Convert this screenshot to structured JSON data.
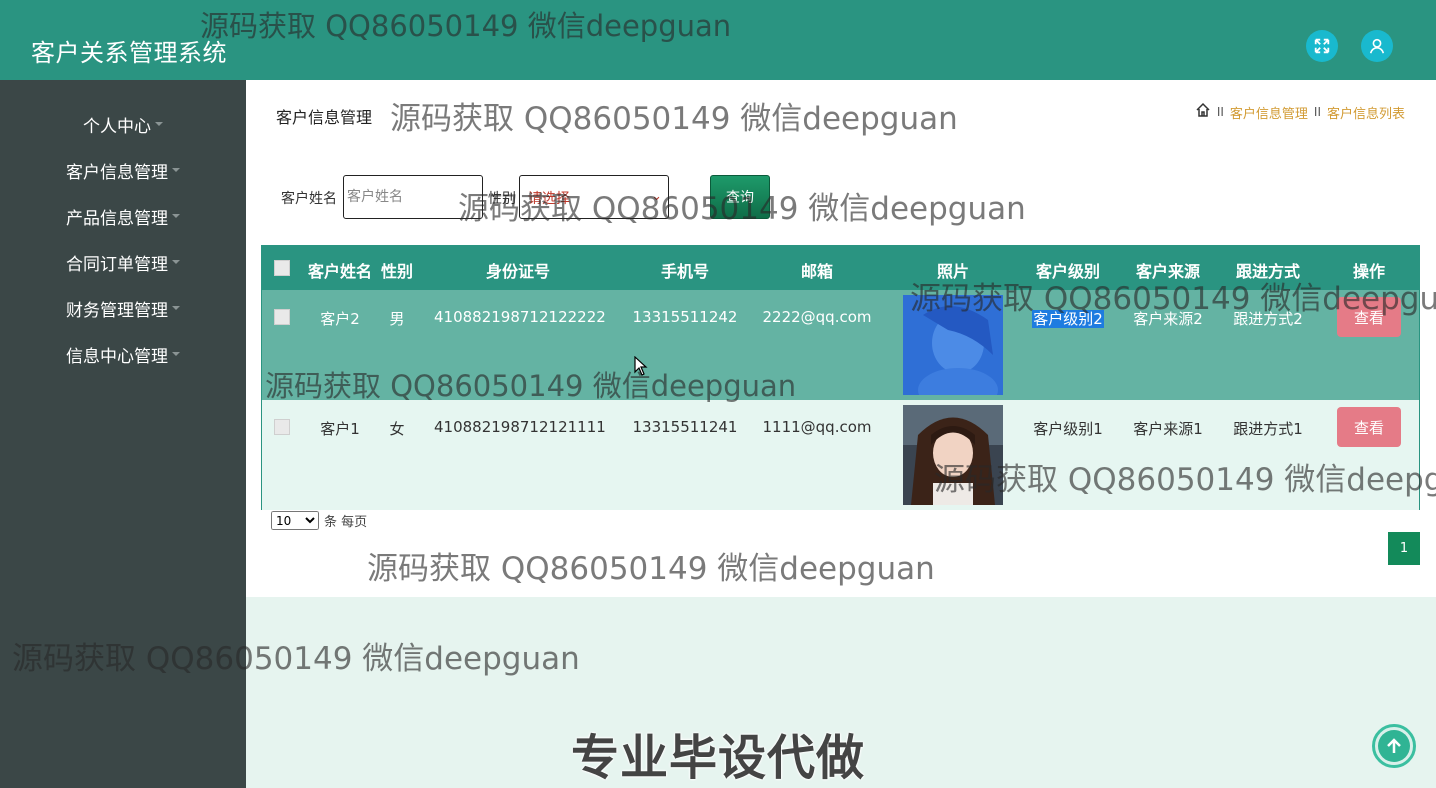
{
  "app": {
    "title": "客户关系管理系统"
  },
  "topbar": {
    "icons": [
      "fullscreen-icon",
      "user-icon"
    ]
  },
  "sidebar": {
    "items": [
      {
        "label": "个人中心"
      },
      {
        "label": "客户信息管理"
      },
      {
        "label": "产品信息管理"
      },
      {
        "label": "合同订单管理"
      },
      {
        "label": "财务管理管理"
      },
      {
        "label": "信息中心管理"
      }
    ]
  },
  "page": {
    "heading": "客户信息管理",
    "breadcrumb": {
      "sep1": "II",
      "level1": "客户信息管理",
      "sep2": "II",
      "level2": "客户信息列表"
    }
  },
  "search": {
    "name_label": "客户姓名",
    "name_placeholder": "客户姓名",
    "gender_label": "性别",
    "gender_value": "请选择",
    "query_button": "查询"
  },
  "table": {
    "columns": [
      "客户姓名",
      "性别",
      "身份证号",
      "手机号",
      "邮箱",
      "照片",
      "客户级别",
      "客户来源",
      "跟进方式",
      "操作"
    ],
    "rows": [
      {
        "name": "客户2",
        "gender": "男",
        "id_number": "410882198712122222",
        "phone": "13315511242",
        "email": "2222@qq.com",
        "level": "客户级别2",
        "source": "客户来源2",
        "follow": "跟进方式2",
        "action": "查看"
      },
      {
        "name": "客户1",
        "gender": "女",
        "id_number": "410882198712121111",
        "phone": "13315511241",
        "email": "1111@qq.com",
        "level": "客户级别1",
        "source": "客户来源1",
        "follow": "跟进方式1",
        "action": "查看"
      }
    ]
  },
  "pagination": {
    "page_size": "10",
    "page_size_suffix": "条 每页",
    "current_page": "1"
  },
  "watermark": {
    "text": "源码获取 QQ86050149 微信deepguan"
  },
  "promo": {
    "text": "专业毕设代做"
  },
  "colors": {
    "header": "#2a9481",
    "sidebar": "#3b4747",
    "accent": "#19b9ce",
    "view_button": "#e57b87"
  }
}
